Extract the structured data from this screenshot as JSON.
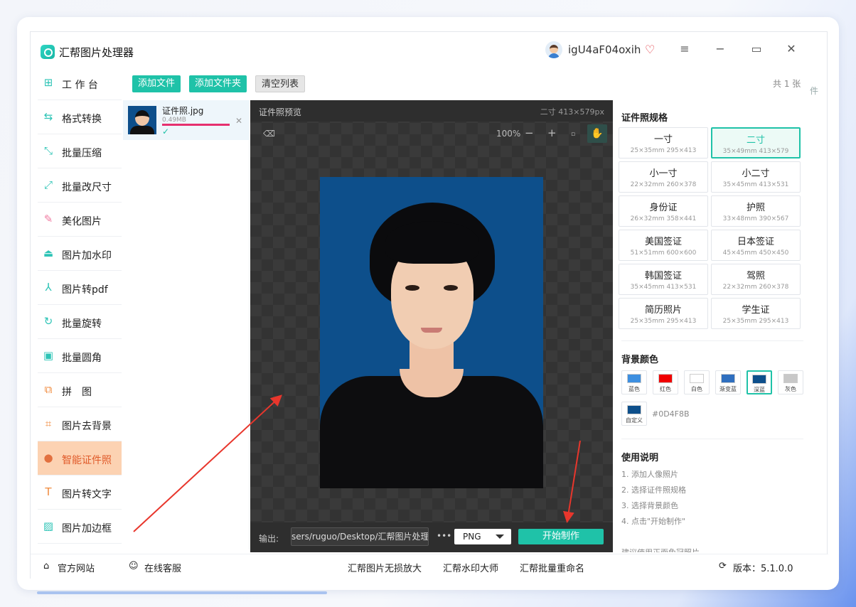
{
  "app": {
    "title": "汇帮图片处理器",
    "username": "igU4aF04oxih"
  },
  "window_controls": {
    "menu": "≡",
    "minimize": "−",
    "maximize": "▭",
    "close": "✕"
  },
  "sidebar": {
    "items": [
      {
        "label": "工 作 台",
        "icon": "grid-icon"
      },
      {
        "label": "格式转换",
        "icon": "convert-icon"
      },
      {
        "label": "批量压缩",
        "icon": "compress-icon"
      },
      {
        "label": "批量改尺寸",
        "icon": "resize-icon"
      },
      {
        "label": "美化图片",
        "icon": "beautify-icon"
      },
      {
        "label": "图片加水印",
        "icon": "watermark-icon"
      },
      {
        "label": "图片转pdf",
        "icon": "pdf-icon"
      },
      {
        "label": "批量旋转",
        "icon": "rotate-icon"
      },
      {
        "label": "批量圆角",
        "icon": "round-corner-icon"
      },
      {
        "label": "拼　图",
        "icon": "puzzle-icon"
      },
      {
        "label": "图片去背景",
        "icon": "crop-icon"
      },
      {
        "label": "智能证件照",
        "icon": "person-icon"
      },
      {
        "label": "图片转文字",
        "icon": "text-icon"
      },
      {
        "label": "图片加边框",
        "icon": "frame-icon"
      }
    ],
    "active_index": 11
  },
  "toolbar": {
    "add_file": "添加文件",
    "add_folder": "添加文件夹",
    "clear_list": "清空列表",
    "count": "共 1 张"
  },
  "file": {
    "name": "证件照.jpg",
    "size": "0.49MB",
    "progress": 1.0
  },
  "preview": {
    "title": "证件照预览",
    "size_label": "二寸 413×579px",
    "zoom": "100%",
    "zoom_out": "−",
    "zoom_in": "+",
    "output_label": "输出:",
    "output_path": "sers/ruguo/Desktop/汇帮图片处理器",
    "more": "•••",
    "format": "PNG",
    "start_button": "开始制作",
    "background_color": "#0D4F8B"
  },
  "specs": {
    "heading": "证件照规格",
    "items": [
      {
        "name": "一寸",
        "dims": "25×35mm 295×413"
      },
      {
        "name": "二寸",
        "dims": "35×49mm 413×579"
      },
      {
        "name": "小一寸",
        "dims": "22×32mm 260×378"
      },
      {
        "name": "小二寸",
        "dims": "35×45mm 413×531"
      },
      {
        "name": "身份证",
        "dims": "26×32mm 358×441"
      },
      {
        "name": "护照",
        "dims": "33×48mm 390×567"
      },
      {
        "name": "美国签证",
        "dims": "51×51mm 600×600"
      },
      {
        "name": "日本签证",
        "dims": "45×45mm 450×450"
      },
      {
        "name": "韩国签证",
        "dims": "35×45mm 413×531"
      },
      {
        "name": "驾照",
        "dims": "22×32mm 260×378"
      },
      {
        "name": "简历照片",
        "dims": "25×35mm 295×413"
      },
      {
        "name": "学生证",
        "dims": "25×35mm 295×413"
      }
    ],
    "selected_index": 1
  },
  "bg_colors": {
    "heading": "背景颜色",
    "items": [
      {
        "label": "蓝色",
        "color": "#3d8fe0"
      },
      {
        "label": "红色",
        "color": "#f00000"
      },
      {
        "label": "白色",
        "color": "#ffffff"
      },
      {
        "label": "渐变蓝",
        "color": "#2f6fbf"
      },
      {
        "label": "深蓝",
        "color": "#0D4F8B"
      },
      {
        "label": "灰色",
        "color": "#c8c8c8"
      }
    ],
    "selected_index": 4,
    "custom": {
      "label": "自定义",
      "color": "#0D4F8B",
      "hex": "#0D4F8B"
    }
  },
  "instructions": {
    "heading": "使用说明",
    "steps": [
      "1. 添加人像照片",
      "2. 选择证件照规格",
      "3. 选择背景颜色",
      "4. 点击\"开始制作\""
    ],
    "tip": "建议使用正面免冠照片"
  },
  "footer": {
    "website": "官方网站",
    "support": "在线客服",
    "link1": "汇帮图片无损放大",
    "link2": "汇帮水印大师",
    "link3": "汇帮批量重命名",
    "version": "版本：5.1.0.0"
  },
  "right_edge_text": "件"
}
